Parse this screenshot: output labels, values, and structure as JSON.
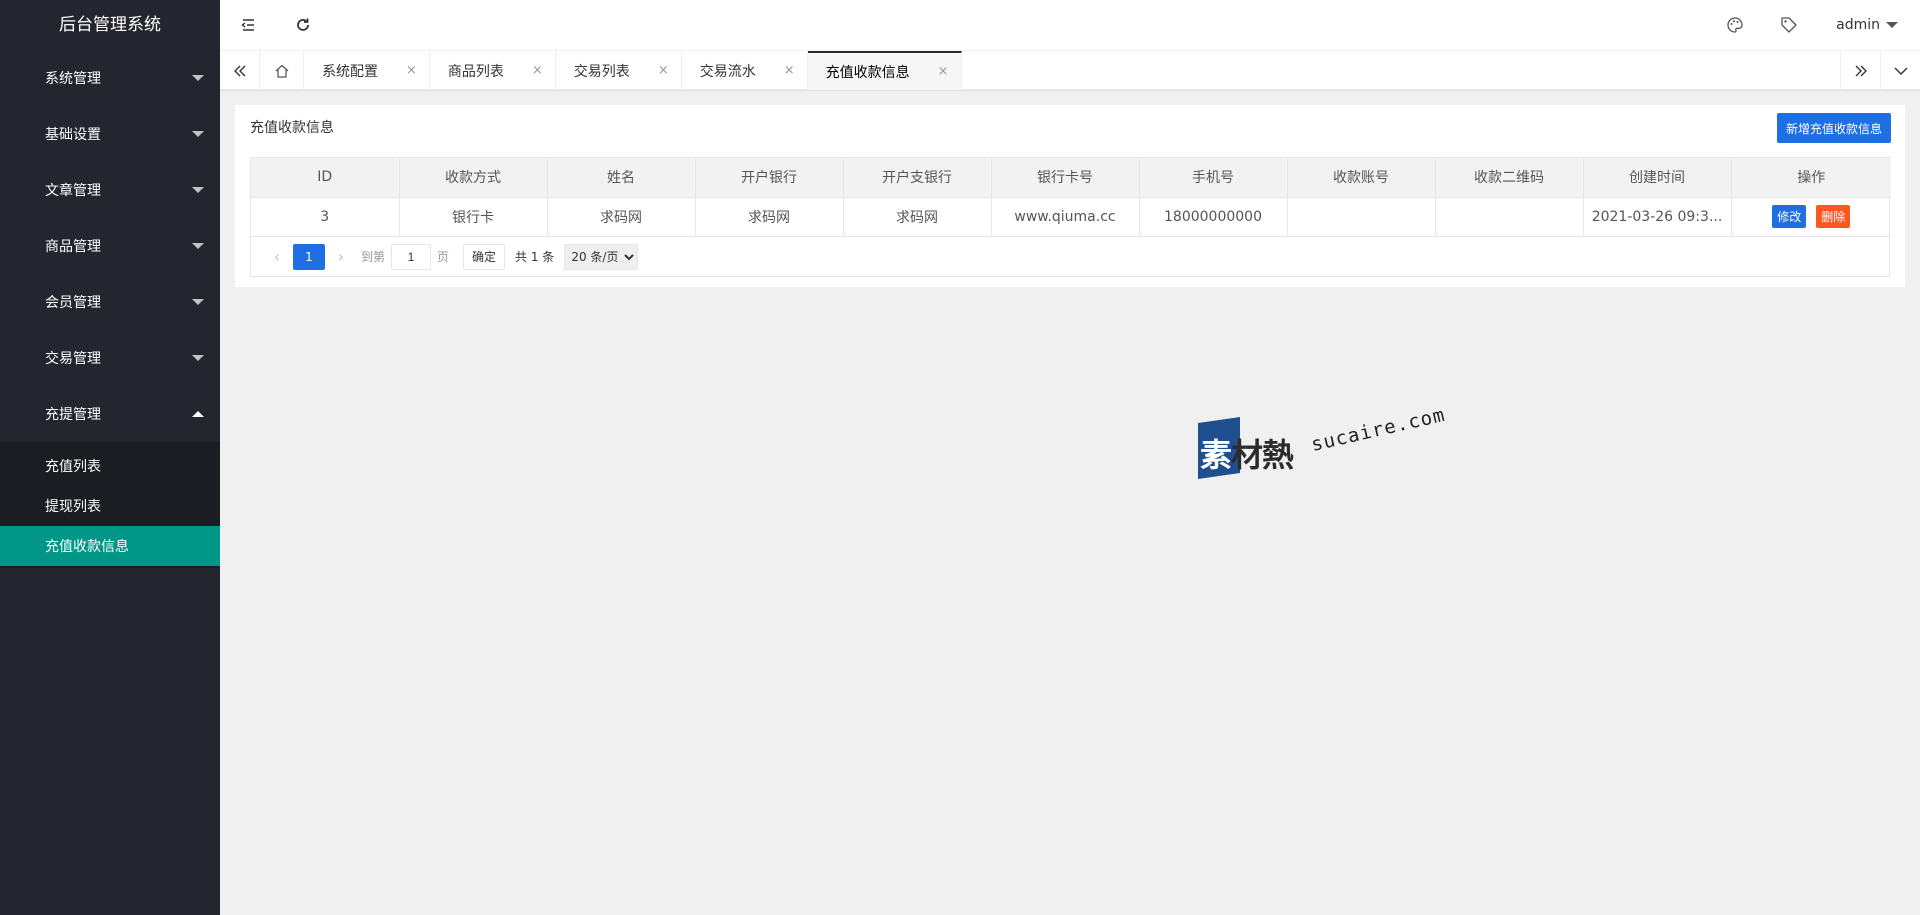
{
  "app": {
    "title": "后台管理系统"
  },
  "sidebar": {
    "items": [
      {
        "label": "系统管理"
      },
      {
        "label": "基础设置"
      },
      {
        "label": "文章管理"
      },
      {
        "label": "商品管理"
      },
      {
        "label": "会员管理"
      },
      {
        "label": "交易管理"
      },
      {
        "label": "充提管理"
      }
    ],
    "sub_items": [
      {
        "label": "充值列表"
      },
      {
        "label": "提现列表"
      },
      {
        "label": "充值收款信息"
      }
    ]
  },
  "header": {
    "user": "admin",
    "icons": [
      "menu-fold-icon",
      "refresh-icon",
      "theme-icon",
      "tag-icon"
    ]
  },
  "tabs": {
    "items": [
      {
        "label": "系统配置"
      },
      {
        "label": "商品列表"
      },
      {
        "label": "交易列表"
      },
      {
        "label": "交易流水"
      },
      {
        "label": "充值收款信息"
      }
    ],
    "close_glyph": "×"
  },
  "card": {
    "title": "充值收款信息",
    "add_button": "新增充值收款信息"
  },
  "table": {
    "columns": [
      "ID",
      "收款方式",
      "姓名",
      "开户银行",
      "开户支银行",
      "银行卡号",
      "手机号",
      "收款账号",
      "收款二维码",
      "创建时间",
      "操作"
    ],
    "rows": [
      {
        "id": "3",
        "method": "银行卡",
        "name": "求码网",
        "bank": "求码网",
        "branch": "求码网",
        "card_no": "www.qiuma.cc",
        "phone": "18000000000",
        "account": "",
        "qrcode": "",
        "created": "2021-03-26 09:3...",
        "edit": "修改",
        "delete": "删除"
      }
    ]
  },
  "pager": {
    "current": "1",
    "goto_label": "到第",
    "page_value": "1",
    "page_unit": "页",
    "ok": "确定",
    "total": "共 1 条",
    "per_page": "20 条/页",
    "prev": "‹",
    "next": "›"
  },
  "watermark": {
    "cn_first": "素",
    "cn_rest": "材熱",
    "en": "sucaire.com"
  }
}
